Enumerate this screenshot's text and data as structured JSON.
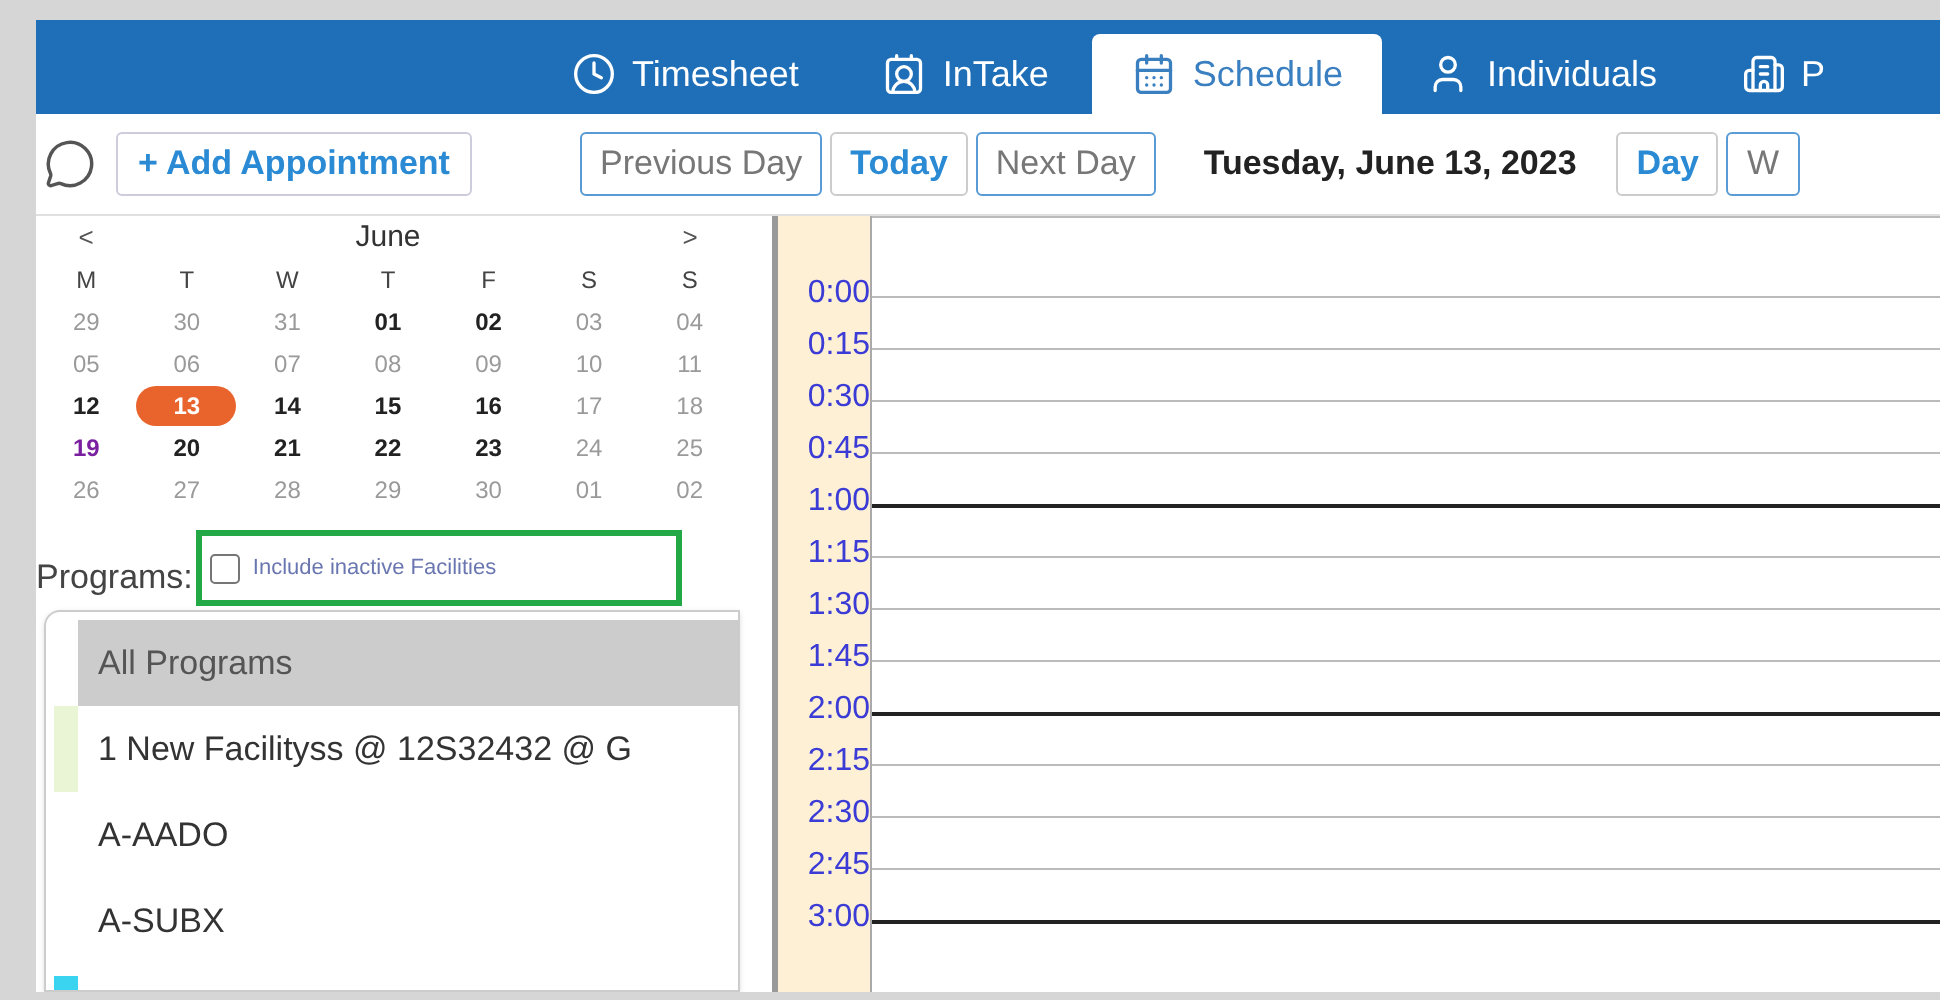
{
  "nav_tabs": [
    {
      "label": "Timesheet",
      "selected": false
    },
    {
      "label": "InTake",
      "selected": false
    },
    {
      "label": "Schedule",
      "selected": true
    },
    {
      "label": "Individuals",
      "selected": false
    },
    {
      "label": "P",
      "selected": false
    }
  ],
  "toolbar": {
    "add_button": "+ Add Appointment",
    "nav_buttons": [
      {
        "label": "Previous Day",
        "selected": true
      },
      {
        "label": "Today",
        "selected": false
      },
      {
        "label": "Next Day",
        "selected": true
      }
    ],
    "date": "Tuesday, June 13, 2023",
    "view_buttons": [
      {
        "label": "Day",
        "selected": false
      },
      {
        "label": "W",
        "selected": true
      }
    ]
  },
  "calendar": {
    "prev": "<",
    "month": "June",
    "next": ">",
    "weekdays": [
      "M",
      "T",
      "W",
      "T",
      "F",
      "S",
      "S"
    ],
    "weeks": [
      [
        {
          "label": "29",
          "kind": "muted"
        },
        {
          "label": "30",
          "kind": "muted"
        },
        {
          "label": "31",
          "kind": "muted"
        },
        {
          "label": "01",
          "kind": "normal"
        },
        {
          "label": "02",
          "kind": "normal"
        },
        {
          "label": "03",
          "kind": "muted"
        },
        {
          "label": "04",
          "kind": "muted"
        }
      ],
      [
        {
          "label": "05",
          "kind": "muted"
        },
        {
          "label": "06",
          "kind": "muted"
        },
        {
          "label": "07",
          "kind": "muted"
        },
        {
          "label": "08",
          "kind": "muted"
        },
        {
          "label": "09",
          "kind": "muted"
        },
        {
          "label": "10",
          "kind": "muted"
        },
        {
          "label": "11",
          "kind": "muted"
        }
      ],
      [
        {
          "label": "12",
          "kind": "normal"
        },
        {
          "label": "13",
          "kind": "today"
        },
        {
          "label": "14",
          "kind": "normal"
        },
        {
          "label": "15",
          "kind": "normal"
        },
        {
          "label": "16",
          "kind": "normal"
        },
        {
          "label": "17",
          "kind": "muted"
        },
        {
          "label": "18",
          "kind": "muted"
        }
      ],
      [
        {
          "label": "19",
          "kind": "holiday"
        },
        {
          "label": "20",
          "kind": "normal"
        },
        {
          "label": "21",
          "kind": "normal"
        },
        {
          "label": "22",
          "kind": "normal"
        },
        {
          "label": "23",
          "kind": "normal"
        },
        {
          "label": "24",
          "kind": "muted"
        },
        {
          "label": "25",
          "kind": "muted"
        }
      ],
      [
        {
          "label": "26",
          "kind": "muted"
        },
        {
          "label": "27",
          "kind": "muted"
        },
        {
          "label": "28",
          "kind": "muted"
        },
        {
          "label": "29",
          "kind": "muted"
        },
        {
          "label": "30",
          "kind": "muted"
        },
        {
          "label": "01",
          "kind": "muted"
        },
        {
          "label": "02",
          "kind": "muted"
        }
      ]
    ]
  },
  "programs": {
    "label": "Programs:",
    "include_inactive": {
      "label": "Include inactive Facilities",
      "checked": false
    },
    "items": [
      {
        "label": "All Programs",
        "selected": true
      },
      {
        "label": "1 New Facilityss @ 12S32432 @ G",
        "selected": false,
        "color": "#eaf5d6"
      },
      {
        "label": "A-AADO",
        "selected": false
      },
      {
        "label": "A-SUBX",
        "selected": false
      },
      {
        "color": "#3ad3f0"
      }
    ]
  },
  "time_slots": [
    {
      "label": "0:00",
      "kind": "quarter"
    },
    {
      "label": "0:15",
      "kind": "quarter"
    },
    {
      "label": "0:30",
      "kind": "quarter"
    },
    {
      "label": "0:45",
      "kind": "quarter"
    },
    {
      "label": "1:00",
      "kind": "hour"
    },
    {
      "label": "1:15",
      "kind": "quarter"
    },
    {
      "label": "1:30",
      "kind": "quarter"
    },
    {
      "label": "1:45",
      "kind": "quarter"
    },
    {
      "label": "2:00",
      "kind": "hour"
    },
    {
      "label": "2:15",
      "kind": "quarter"
    },
    {
      "label": "2:30",
      "kind": "quarter"
    },
    {
      "label": "2:45",
      "kind": "quarter"
    },
    {
      "label": "3:00",
      "kind": "hour"
    }
  ]
}
